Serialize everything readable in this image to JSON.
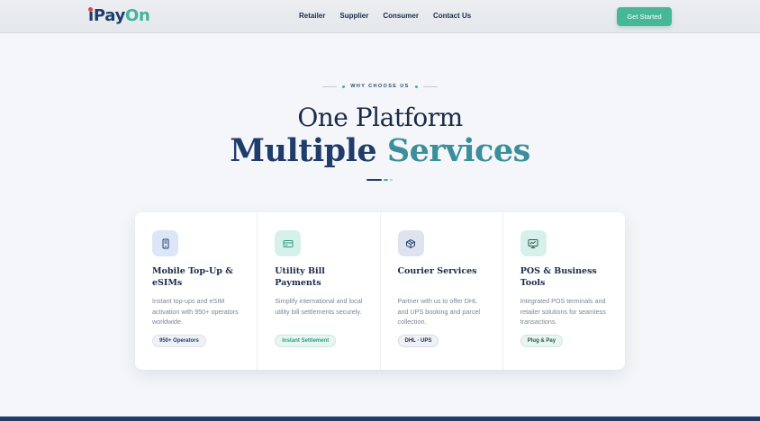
{
  "header": {
    "logo": {
      "part1": "i",
      "part2": "Pay",
      "part3": "On"
    },
    "nav": [
      "Retailer",
      "Supplier",
      "Consumer",
      "Contact Us"
    ],
    "cta_label": "Get Started"
  },
  "section": {
    "eyebrow": "WHY CHOOSE US",
    "title_line1": "One Platform",
    "title_line2_a": "Multiple",
    "title_line2_b": "Services"
  },
  "cards": [
    {
      "icon": "mobile-phone-icon",
      "icon_bg": "#dce6f6",
      "icon_color": "#1f3c6b",
      "title": "Mobile Top-Up & eSIMs",
      "desc": "Instant top-ups and eSIM activation with 950+ operators worldwide.",
      "badge": "950+ Operators"
    },
    {
      "icon": "credit-card-icon",
      "icon_bg": "#d6f1ea",
      "icon_color": "#2f9c7e",
      "title": "Utility Bill Payments",
      "desc": "Simplify international and local utility bill settlements securely.",
      "badge": "Instant Settlement"
    },
    {
      "icon": "package-icon",
      "icon_bg": "#dfe3f0",
      "icon_color": "#1f3c6b",
      "title": "Courier Services",
      "desc": "Partner with us to offer DHL and UPS booking and parcel collection.",
      "badge": "DHL · UPS"
    },
    {
      "icon": "monitor-icon",
      "icon_bg": "#d6f1ea",
      "icon_color": "#245a4c",
      "title": "POS & Business Tools",
      "desc": "Integrated POS terminals and retailer solutions for seamless transactions.",
      "badge": "Plug & Pay"
    }
  ]
}
